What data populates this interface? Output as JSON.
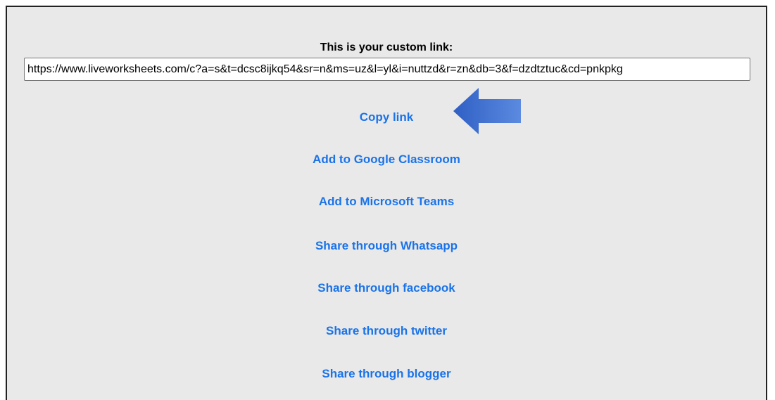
{
  "panel": {
    "title": "This is your custom link:",
    "link_value": "https://www.liveworksheets.com/c?a=s&t=dcsc8ijkq54&sr=n&ms=uz&l=yl&i=nuttzd&r=zn&db=3&f=dzdtztuc&cd=pnkpkg"
  },
  "actions": {
    "copy_link": "Copy link",
    "google_classroom": "Add to Google Classroom",
    "microsoft_teams": "Add to Microsoft Teams",
    "whatsapp": "Share through Whatsapp",
    "facebook": "Share through facebook",
    "twitter": "Share through twitter",
    "blogger": "Share through blogger"
  },
  "colors": {
    "action_link": "#1a73e8",
    "arrow_fill": "#3f6fcf",
    "panel_background": "#e9e9e9"
  },
  "icons": {
    "pointer": "left-arrow-icon"
  }
}
